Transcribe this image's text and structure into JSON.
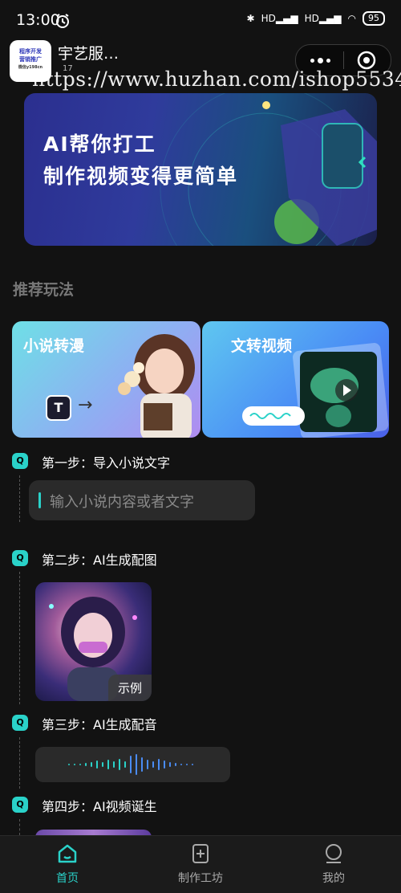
{
  "status_bar": {
    "time": "13:00",
    "battery": "95",
    "signal1": "HD",
    "signal2": "HD"
  },
  "header": {
    "app_name": "宇艺服…",
    "sub_text": "17",
    "watermark": "https://www.huzhan.com/ishop5534",
    "logo": {
      "line1": "程序开发",
      "line2": "营销推广",
      "line3": "微信y198cn"
    }
  },
  "banner": {
    "line1": "AI帮你打工",
    "line2": "制作视频变得更简单"
  },
  "section": {
    "title": "推荐玩法"
  },
  "cards": [
    {
      "title": "小说转漫",
      "icon": "T"
    },
    {
      "title": "文转视频"
    }
  ],
  "steps": [
    {
      "label": "第一步：导入小说文字"
    },
    {
      "label": "第二步：AI生成配图"
    },
    {
      "label": "第三步：AI生成配音"
    },
    {
      "label": "第四步：AI视频诞生"
    }
  ],
  "input": {
    "placeholder": "输入小说内容或者文字"
  },
  "sample": {
    "tag": "示例"
  },
  "tabs": [
    {
      "label": "首页",
      "active": true,
      "icon": "home-icon"
    },
    {
      "label": "制作工坊",
      "active": false,
      "icon": "add-doc-icon"
    },
    {
      "label": "我的",
      "active": false,
      "icon": "user-icon"
    }
  ],
  "colors": {
    "accent": "#2ad2c9",
    "bg": "#121212"
  }
}
